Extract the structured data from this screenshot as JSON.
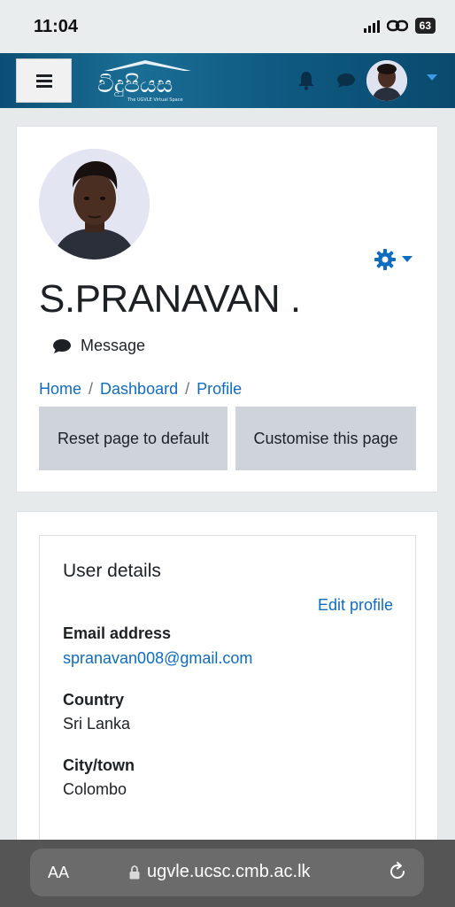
{
  "status": {
    "time": "11:04",
    "battery": "63"
  },
  "nav": {
    "logo_text": "විදුපියස",
    "logo_subtitle": "The UGVLE Virtual Space"
  },
  "profile": {
    "name": "S.PRANAVAN .",
    "message_label": "Message",
    "breadcrumbs": [
      "Home",
      "Dashboard",
      "Profile"
    ],
    "reset_label": "Reset page to default",
    "customise_label": "Customise this page"
  },
  "user_details": {
    "title": "User details",
    "edit_label": "Edit profile",
    "fields": [
      {
        "label": "Email address",
        "value": "spranavan008@gmail.com"
      },
      {
        "label": "Country",
        "value": "Sri Lanka"
      },
      {
        "label": "City/town",
        "value": "Colombo"
      }
    ]
  },
  "browser": {
    "text_size_label": "AA",
    "url": "ugvle.ucsc.cmb.ac.lk"
  },
  "colors": {
    "accent": "#0f6cbf",
    "nav_bg": "#0f5a82",
    "button_bg": "#ced4da"
  },
  "icons": [
    "hamburger-icon",
    "bell-icon",
    "chat-icon",
    "caret-down-icon",
    "gear-icon",
    "message-icon",
    "lock-icon",
    "reload-icon"
  ]
}
